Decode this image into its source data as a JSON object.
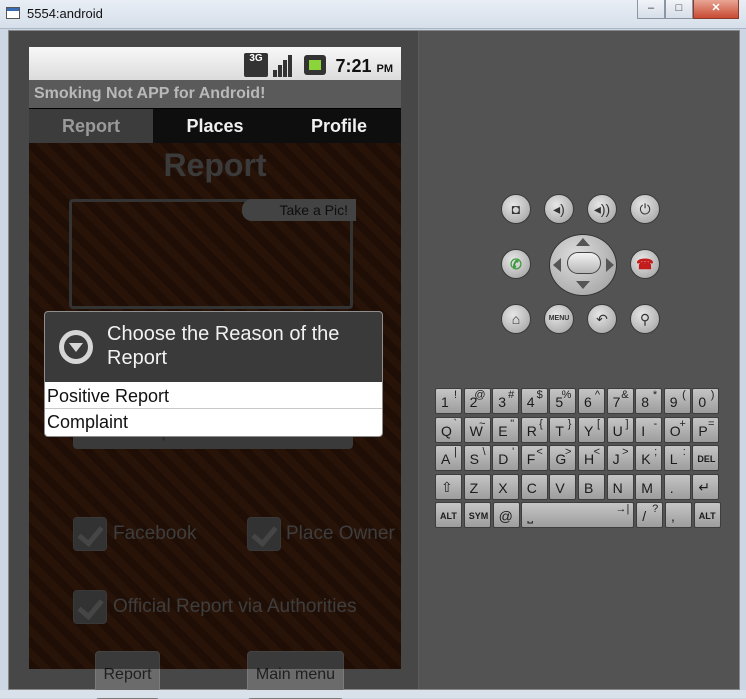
{
  "window": {
    "title": "5554:android",
    "minimize": "–",
    "maximize": "□",
    "close": "✕"
  },
  "status_bar": {
    "network": "3G",
    "time": "7:21",
    "ampm": "PM"
  },
  "app": {
    "title": "Smoking Not APP for Android!"
  },
  "tabs": [
    {
      "label": "Report",
      "selected": true
    },
    {
      "label": "Places"
    },
    {
      "label": "Profile"
    }
  ],
  "report": {
    "heading": "Report",
    "take_pic": "Take a Pic!",
    "reason_value": "Positive Report",
    "checkboxes": {
      "facebook": "Facebook",
      "place_owner": "Place Owner",
      "official": "Official Report via Authorities"
    },
    "buttons": {
      "report": "Report",
      "main_menu": "Main menu"
    }
  },
  "dialog": {
    "title": "Choose the Reason of the Report",
    "options": [
      "Positive Report",
      "Complaint"
    ]
  },
  "controls": {
    "menu": "MENU"
  },
  "keyboard": {
    "rows": [
      [
        {
          "m": "1",
          "s": "!"
        },
        {
          "m": "2",
          "s": "@"
        },
        {
          "m": "3",
          "s": "#"
        },
        {
          "m": "4",
          "s": "$"
        },
        {
          "m": "5",
          "s": "%"
        },
        {
          "m": "6",
          "s": "^"
        },
        {
          "m": "7",
          "s": "&"
        },
        {
          "m": "8",
          "s": "*"
        },
        {
          "m": "9",
          "s": "("
        },
        {
          "m": "0",
          "s": ")"
        }
      ],
      [
        {
          "m": "Q",
          "s": "`"
        },
        {
          "m": "W",
          "s": "~"
        },
        {
          "m": "E",
          "s": "\""
        },
        {
          "m": "R",
          "s": "{"
        },
        {
          "m": "T",
          "s": "}"
        },
        {
          "m": "Y",
          "s": "["
        },
        {
          "m": "U",
          "s": "]"
        },
        {
          "m": "I",
          "s": "-"
        },
        {
          "m": "O",
          "s": "+"
        },
        {
          "m": "P",
          "s": "="
        }
      ],
      [
        {
          "m": "A",
          "s": "|"
        },
        {
          "m": "S",
          "s": "\\"
        },
        {
          "m": "D",
          "s": "'"
        },
        {
          "m": "F",
          "s": "<"
        },
        {
          "m": "G",
          "s": ">"
        },
        {
          "m": "H",
          "s": "<"
        },
        {
          "m": "J",
          "s": ">"
        },
        {
          "m": "K",
          "s": ";"
        },
        {
          "m": "L",
          "s": ":"
        },
        {
          "m": "DEL",
          "s": ""
        }
      ],
      [
        {
          "m": "⇧",
          "s": ""
        },
        {
          "m": "Z",
          "s": ""
        },
        {
          "m": "X",
          "s": ""
        },
        {
          "m": "C",
          "s": ""
        },
        {
          "m": "V",
          "s": ""
        },
        {
          "m": "B",
          "s": ""
        },
        {
          "m": "N",
          "s": ""
        },
        {
          "m": "M",
          "s": ""
        },
        {
          "m": ".",
          "s": ""
        },
        {
          "m": "↵",
          "s": ""
        }
      ],
      [
        {
          "m": "ALT",
          "s": ""
        },
        {
          "m": "SYM",
          "s": ""
        },
        {
          "m": "@",
          "s": ""
        },
        {
          "m": "⎵",
          "s": "→|"
        },
        {
          "m": "/",
          "s": "?"
        },
        {
          "m": ",",
          "s": ""
        },
        {
          "m": "ALT",
          "s": ""
        }
      ]
    ]
  },
  "colors": {
    "accept_call": "#3a9a3a",
    "end_call": "#c41a1a"
  }
}
